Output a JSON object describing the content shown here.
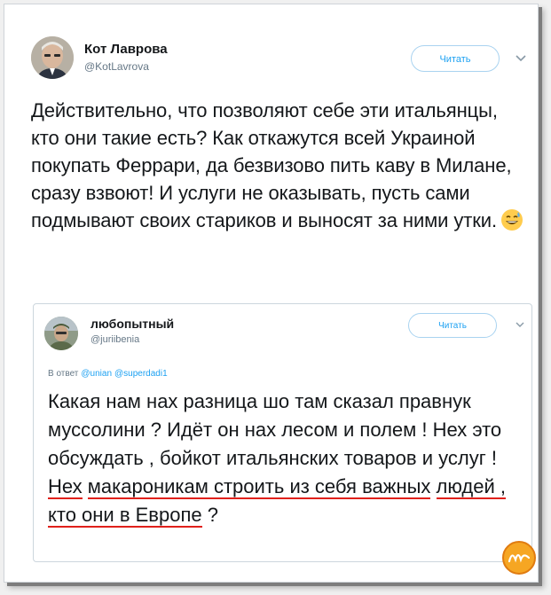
{
  "tweet": {
    "display_name": "Кот Лаврова",
    "handle": "@KotLavrova",
    "follow_label": "Читать",
    "text": "Действительно, что позволяют себе эти итальянцы, кто они такие есть? Как откажутся всей Украиной покупать Феррари, да безвизово пить каву в Милане, сразу взвоют! И услуги не оказывать, пусть сами подмывают своих стариков и выносят за ними утки.",
    "emoji": "grinning-sweat-emoji"
  },
  "quote": {
    "display_name": "любопытный",
    "handle": "@juriibenia",
    "follow_label": "Читать",
    "reply_prefix": "В ответ",
    "reply_mentions": [
      "@unian",
      "@superdadi1"
    ],
    "text_plain": "Какая нам нах разница шо там сказал правнук муссолини ? Идёт он нах лесом и полем ! Нех это обсуждать , бойкот итальянских товаров  и услуг ! ",
    "text_underlined_1": "Нех",
    "text_underlined_2": "макароникам строить из себя важных",
    "text_underlined_3": "людей , кто они в Европе",
    "text_tail": " ?"
  },
  "icons": {
    "chevron": "chevron-down-icon",
    "watermark": "watermark-logo"
  },
  "colors": {
    "accent": "#1da1f2",
    "underline": "#e0201b",
    "text": "#14171a",
    "muted": "#657786"
  }
}
